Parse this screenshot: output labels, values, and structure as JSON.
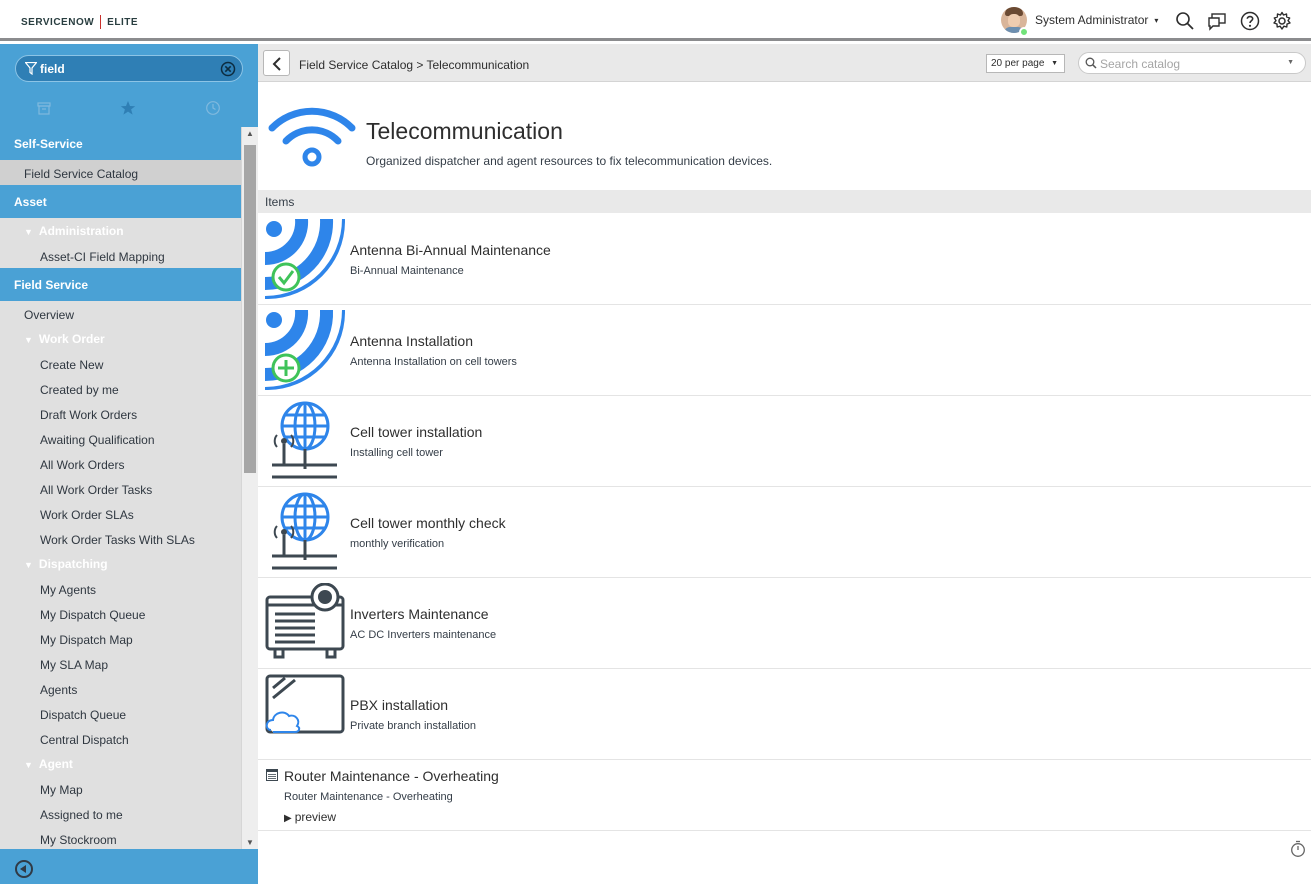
{
  "banner": {
    "brand_left": "SERVICENOW",
    "brand_right": "ELITE",
    "user_name": "System Administrator",
    "user_caret": "▾"
  },
  "nav": {
    "filter_value": "field",
    "sections": [
      {
        "type": "section",
        "label": "Self-Service"
      },
      {
        "type": "module",
        "label": "Field Service Catalog",
        "active": true
      },
      {
        "type": "section",
        "label": "Asset"
      },
      {
        "type": "group",
        "label": "Administration"
      },
      {
        "type": "sub",
        "label": "Asset-CI Field Mapping"
      },
      {
        "type": "section",
        "label": "Field Service"
      },
      {
        "type": "module",
        "label": "Overview"
      },
      {
        "type": "group",
        "label": "Work Order"
      },
      {
        "type": "sub",
        "label": "Create New"
      },
      {
        "type": "sub",
        "label": "Created by me"
      },
      {
        "type": "sub",
        "label": "Draft Work Orders"
      },
      {
        "type": "sub",
        "label": "Awaiting Qualification"
      },
      {
        "type": "sub",
        "label": "All Work Orders"
      },
      {
        "type": "sub",
        "label": "All Work Order Tasks"
      },
      {
        "type": "sub",
        "label": "Work Order SLAs"
      },
      {
        "type": "sub",
        "label": "Work Order Tasks With SLAs"
      },
      {
        "type": "group",
        "label": "Dispatching"
      },
      {
        "type": "sub",
        "label": "My Agents"
      },
      {
        "type": "sub",
        "label": "My Dispatch Queue"
      },
      {
        "type": "sub",
        "label": "My Dispatch Map"
      },
      {
        "type": "sub",
        "label": "My SLA Map"
      },
      {
        "type": "sub",
        "label": "Agents"
      },
      {
        "type": "sub",
        "label": "Dispatch Queue"
      },
      {
        "type": "sub",
        "label": "Central Dispatch"
      },
      {
        "type": "group",
        "label": "Agent"
      },
      {
        "type": "sub",
        "label": "My Map"
      },
      {
        "type": "sub",
        "label": "Assigned to me"
      },
      {
        "type": "sub",
        "label": "My Stockroom"
      }
    ]
  },
  "toolbar": {
    "breadcrumb": "Field Service Catalog > Telecommunication",
    "per_page": "20 per page",
    "search_placeholder": "Search catalog"
  },
  "category": {
    "title": "Telecommunication",
    "description": "Organized dispatcher and agent resources to fix telecommunication devices."
  },
  "items_label": "Items",
  "items": [
    {
      "title": "Antenna Bi-Annual Maintenance",
      "description": "Bi-Annual Maintenance",
      "icon": "antenna-check-icon"
    },
    {
      "title": "Antenna Installation",
      "description": "Antenna Installation on cell towers",
      "icon": "antenna-plus-icon"
    },
    {
      "title": "Cell tower installation",
      "description": "Installing cell tower",
      "icon": "cell-tower-globe-icon"
    },
    {
      "title": "Cell tower monthly check",
      "description": "monthly verification",
      "icon": "cell-tower-globe-icon"
    },
    {
      "title": "Inverters Maintenance",
      "description": "AC DC Inverters maintenance",
      "icon": "inverter-icon"
    },
    {
      "title": "PBX installation",
      "description": "Private branch installation",
      "icon": "pbx-cloud-icon"
    }
  ],
  "router_item": {
    "title": "Router Maintenance - Overheating",
    "description": "Router Maintenance - Overheating",
    "preview": "preview"
  },
  "colors": {
    "accent": "#4aa1d5",
    "icon_blue": "#2e85ea",
    "icon_green": "#3fc35a",
    "icon_dark": "#3d4851"
  }
}
